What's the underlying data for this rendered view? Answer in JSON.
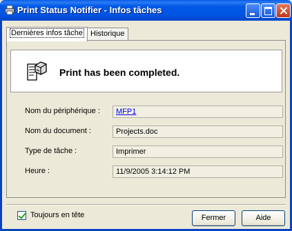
{
  "window": {
    "title": "Print Status Notifier - Infos tâches"
  },
  "tabs": [
    {
      "label": "Dernières infos tâche"
    },
    {
      "label": "Historique"
    }
  ],
  "message": "Print has been completed.",
  "fields": [
    {
      "label": "Nom du périphérique :",
      "value": "MFP1"
    },
    {
      "label": "Nom du document :",
      "value": "Projects.doc"
    },
    {
      "label": "Type de tâche :",
      "value": "Imprimer"
    },
    {
      "label": "Heure :",
      "value": "11/9/2005 3:14:12 PM"
    }
  ],
  "footer": {
    "always_on_top_label": "Toujours en tête",
    "always_on_top_checked": true,
    "close_label": "Fermer",
    "help_label": "Aide"
  },
  "colors": {
    "titlebar": "#0055e3",
    "face": "#ece9d8",
    "link": "#0000ee"
  },
  "icons": {
    "title": "printer-icon",
    "message": "document-printer-icon"
  }
}
